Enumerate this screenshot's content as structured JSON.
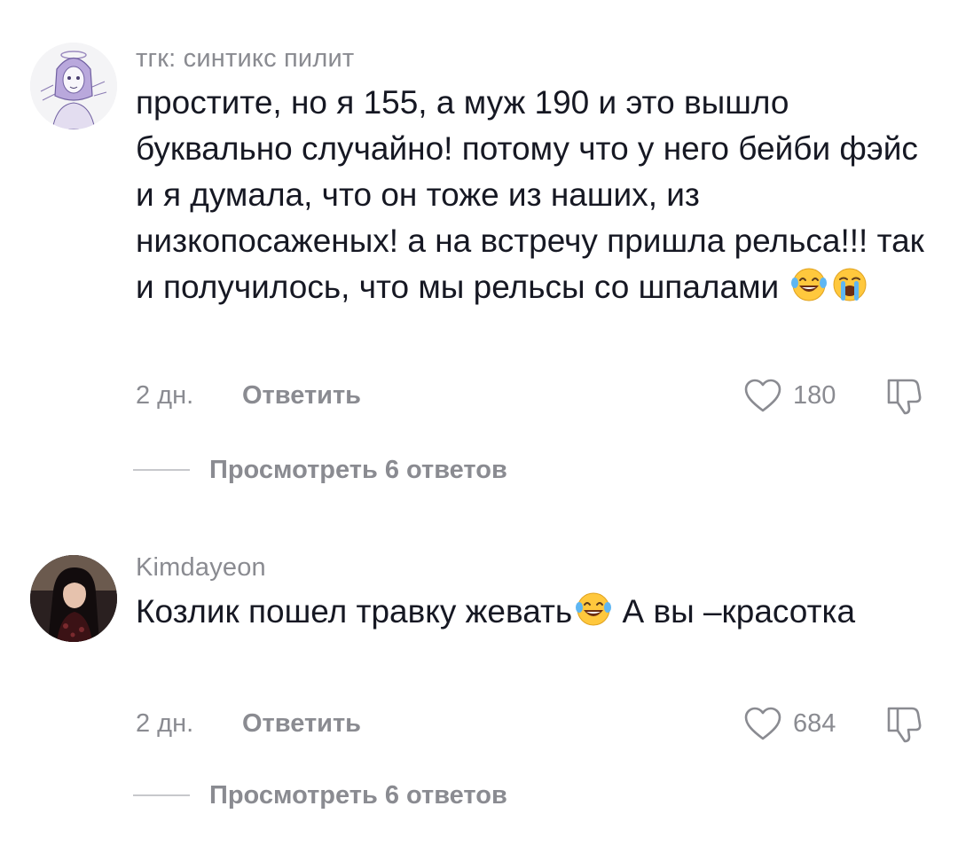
{
  "comments": [
    {
      "username": "тгк: синтикс пилит",
      "text": "простите, но я 155, а муж 190 и это вышло буквально случайно! потому что у него бейби фэйс и я думала, что он тоже из наших, из низкопосаженых! а на встречу пришла рельса!!! так и получилось, что мы рельсы со шпалами",
      "emojis": [
        "face-with-tears-of-joy",
        "loudly-crying-face"
      ],
      "time": "2 дн.",
      "reply_label": "Ответить",
      "likes": "180",
      "view_replies": "Просмотреть 6 ответов"
    },
    {
      "username": "Kimdayeon",
      "text_part1": "Козлик пошел травку жевать",
      "text_part2": " А вы –красотка",
      "emojis": [
        "face-with-tears-of-joy"
      ],
      "time": "2 дн.",
      "reply_label": "Ответить",
      "likes": "684",
      "view_replies": "Просмотреть 6 ответов"
    }
  ],
  "icons": {
    "like": "heart-outline-icon",
    "dislike": "thumbs-down-outline-icon"
  },
  "colors": {
    "primary_text": "#161823",
    "secondary_text": "#8a8b91",
    "divider": "#c7c8cc"
  }
}
